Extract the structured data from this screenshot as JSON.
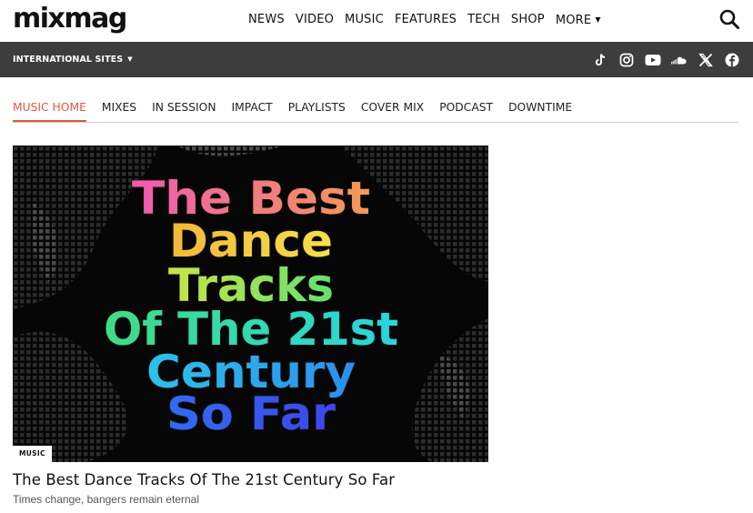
{
  "header": {
    "logo": "mixmag",
    "nav": [
      "NEWS",
      "VIDEO",
      "MUSIC",
      "FEATURES",
      "TECH",
      "SHOP",
      "MORE"
    ],
    "search_icon": "search-icon"
  },
  "intl_bar": {
    "label": "INTERNATIONAL SITES",
    "socials": [
      "tiktok-icon",
      "instagram-icon",
      "youtube-icon",
      "soundcloud-icon",
      "x-icon",
      "facebook-icon"
    ]
  },
  "subnav": {
    "items": [
      "MUSIC HOME",
      "MIXES",
      "IN SESSION",
      "IMPACT",
      "PLAYLISTS",
      "COVER MIX",
      "PODCAST",
      "DOWNTIME"
    ],
    "active_index": 0,
    "accent_color": "#e4553f"
  },
  "feature": {
    "image_lines": [
      "The Best",
      "Dance",
      "Tracks",
      "Of The 21st",
      "Century",
      "So Far"
    ],
    "tag": "MUSIC",
    "title": "The Best Dance Tracks Of The 21st Century So Far",
    "subtitle": "Times change, bangers remain eternal"
  }
}
